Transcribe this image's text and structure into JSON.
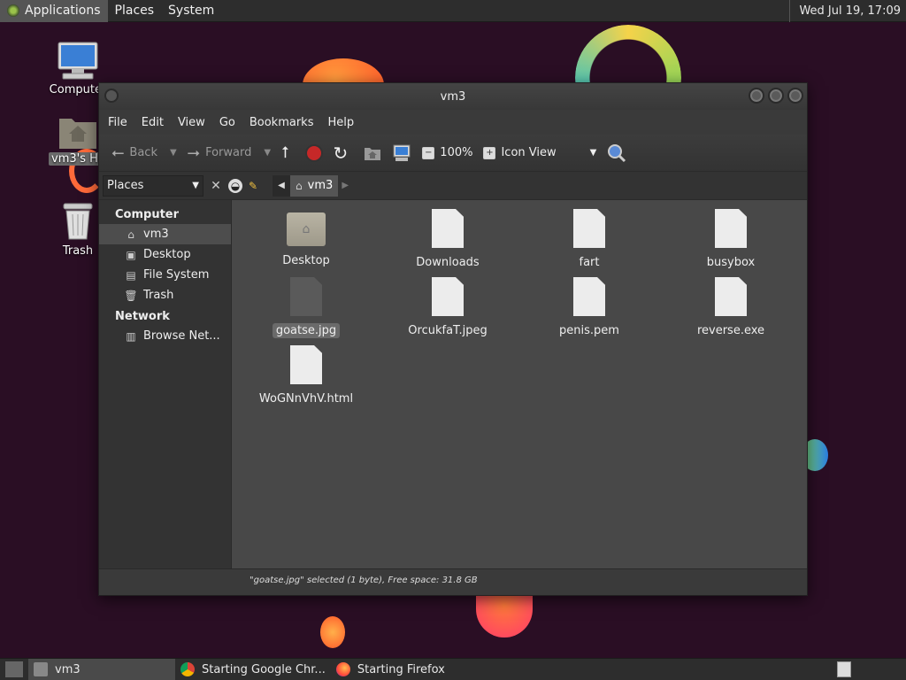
{
  "top_panel": {
    "menus": [
      "Applications",
      "Places",
      "System"
    ],
    "clock": "Wed Jul 19, 17:09"
  },
  "desktop": {
    "icons": [
      {
        "label": "Computer"
      },
      {
        "label": "vm3's Home"
      },
      {
        "label": "Trash"
      }
    ]
  },
  "window": {
    "title": "vm3",
    "menubar": [
      "File",
      "Edit",
      "View",
      "Go",
      "Bookmarks",
      "Help"
    ],
    "toolbar": {
      "back": "Back",
      "forward": "Forward",
      "zoom": "100%",
      "view_mode": "Icon View"
    },
    "location": {
      "places_label": "Places",
      "crumb": "vm3"
    },
    "sidebar": {
      "computer_header": "Computer",
      "computer_items": [
        "vm3",
        "Desktop",
        "File System",
        "Trash"
      ],
      "network_header": "Network",
      "network_items": [
        "Browse Net..."
      ]
    },
    "files": [
      {
        "name": "Desktop",
        "kind": "folder"
      },
      {
        "name": "Downloads",
        "kind": "file"
      },
      {
        "name": "fart",
        "kind": "file"
      },
      {
        "name": "busybox",
        "kind": "file"
      },
      {
        "name": "goatse.jpg",
        "kind": "image"
      },
      {
        "name": "OrcukfaT.jpeg",
        "kind": "file"
      },
      {
        "name": "penis.pem",
        "kind": "file"
      },
      {
        "name": "reverse.exe",
        "kind": "file"
      },
      {
        "name": "WoGNnVhV.html",
        "kind": "file"
      }
    ],
    "status": "\"goatse.jpg\" selected (1 byte), Free space: 31.8 GB"
  },
  "bottom_panel": {
    "tasks": [
      "vm3",
      "Starting Google Chr...",
      "Starting Firefox"
    ]
  }
}
